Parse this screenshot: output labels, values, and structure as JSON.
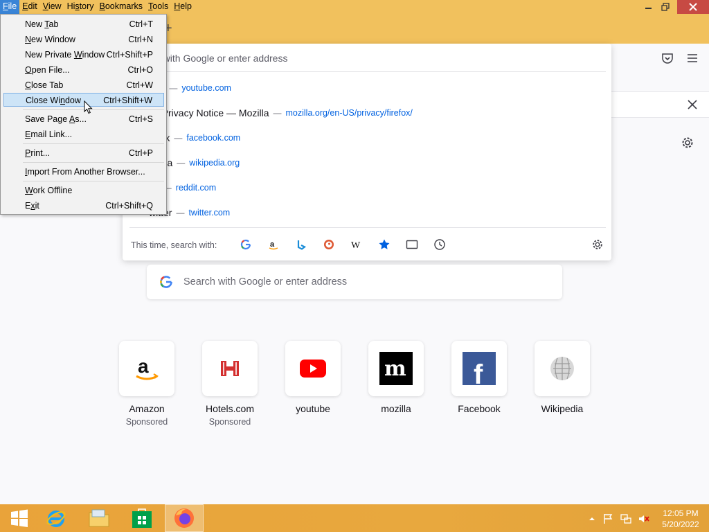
{
  "menubar": [
    {
      "pre": "",
      "acc": "F",
      "post": "ile"
    },
    {
      "pre": "",
      "acc": "E",
      "post": "dit"
    },
    {
      "pre": "",
      "acc": "V",
      "post": "iew"
    },
    {
      "pre": "Hi",
      "acc": "s",
      "post": "tory"
    },
    {
      "pre": "",
      "acc": "B",
      "post": "ookmarks"
    },
    {
      "pre": "",
      "acc": "T",
      "post": "ools"
    },
    {
      "pre": "",
      "acc": "H",
      "post": "elp"
    }
  ],
  "file_menu": {
    "items": [
      {
        "pre": "New ",
        "acc": "T",
        "post": "ab",
        "shortcut": "Ctrl+T"
      },
      {
        "pre": "",
        "acc": "N",
        "post": "ew Window",
        "shortcut": "Ctrl+N"
      },
      {
        "pre": "New Private ",
        "acc": "W",
        "post": "indow",
        "shortcut": "Ctrl+Shift+P"
      },
      {
        "pre": "",
        "acc": "O",
        "post": "pen File...",
        "shortcut": "Ctrl+O"
      },
      {
        "pre": "",
        "acc": "C",
        "post": "lose Tab",
        "shortcut": "Ctrl+W"
      },
      {
        "pre": "Close Wi",
        "acc": "n",
        "post": "dow",
        "shortcut": "Ctrl+Shift+W"
      },
      {
        "pre": "Save Page ",
        "acc": "A",
        "post": "s...",
        "shortcut": "Ctrl+S"
      },
      {
        "pre": "",
        "acc": "E",
        "post": "mail Link...",
        "shortcut": ""
      },
      {
        "pre": "",
        "acc": "P",
        "post": "rint...",
        "shortcut": "Ctrl+P"
      },
      {
        "pre": "",
        "acc": "I",
        "post": "mport From Another Browser...",
        "shortcut": ""
      },
      {
        "pre": "",
        "acc": "W",
        "post": "ork Offline",
        "shortcut": ""
      },
      {
        "pre": "E",
        "acc": "x",
        "post": "it",
        "shortcut": "Ctrl+Shift+Q"
      }
    ]
  },
  "urlbar": {
    "placeholder": "ch with Google or enter address",
    "suggestions": [
      {
        "title": "ube",
        "url": "youtube.com"
      },
      {
        "title": "ox Privacy Notice — Mozilla",
        "url": "mozilla.org/en-US/privacy/firefox/"
      },
      {
        "title": "book",
        "url": "facebook.com"
      },
      {
        "title": "pedia",
        "url": "wikipedia.org"
      },
      {
        "title": "dit",
        "url": "reddit.com"
      },
      {
        "title": "witter",
        "url": "twitter.com"
      }
    ],
    "oneoff_label": "This time, search with:"
  },
  "newtab": {
    "search_placeholder": "Search with Google or enter address",
    "top_sites": [
      {
        "label": "Amazon",
        "sponsored": "Sponsored"
      },
      {
        "label": "Hotels.com",
        "sponsored": "Sponsored"
      },
      {
        "label": "youtube",
        "sponsored": ""
      },
      {
        "label": "mozilla",
        "sponsored": ""
      },
      {
        "label": "Facebook",
        "sponsored": ""
      },
      {
        "label": "Wikipedia",
        "sponsored": ""
      }
    ]
  },
  "taskbar": {
    "time": "12:05 PM",
    "date": "5/20/2022"
  },
  "colors": {
    "titlebar": "#f1c15d",
    "menu_highlight": "#cde4f7",
    "link": "#0061e0",
    "taskbar": "#e9a33a"
  }
}
